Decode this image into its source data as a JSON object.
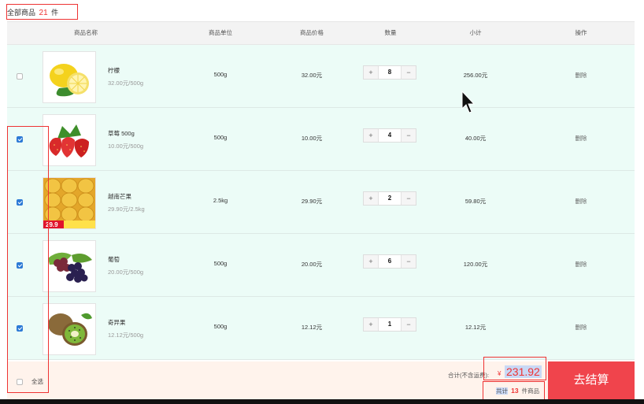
{
  "summary": {
    "prefix": "全部商品",
    "count": "21",
    "unit": "件"
  },
  "table": {
    "headers": [
      "商品名称",
      "商品单位",
      "商品价格",
      "数量",
      "小计",
      "操作"
    ],
    "rows": [
      {
        "checked": false,
        "name": "柠檬",
        "unit_price": "32.00元/500g",
        "unit": "500g",
        "price": "32.00元",
        "qty": "8",
        "subtotal": "256.00元",
        "action": "删除",
        "fruit": "lemon-image"
      },
      {
        "checked": true,
        "name": "草莓 500g",
        "unit_price": "10.00元/500g",
        "unit": "500g",
        "price": "10.00元",
        "qty": "4",
        "subtotal": "40.00元",
        "action": "删除",
        "fruit": "strawberry-image"
      },
      {
        "checked": true,
        "name": "越南芒果",
        "unit_price": "29.90元/2.5kg",
        "unit": "2.5kg",
        "price": "29.90元",
        "qty": "2",
        "subtotal": "59.80元",
        "action": "删除",
        "fruit": "mango-image",
        "badge": "29.9"
      },
      {
        "checked": true,
        "name": "葡萄",
        "unit_price": "20.00元/500g",
        "unit": "500g",
        "price": "20.00元",
        "qty": "6",
        "subtotal": "120.00元",
        "action": "删除",
        "fruit": "grape-image"
      },
      {
        "checked": true,
        "name": "奇异果",
        "unit_price": "12.12元/500g",
        "unit": "500g",
        "price": "12.12元",
        "qty": "1",
        "subtotal": "12.12元",
        "action": "删除",
        "fruit": "kiwi-image"
      }
    ]
  },
  "stepper": {
    "plus": "+",
    "minus": "−"
  },
  "footer": {
    "select_all": "全选",
    "total_label": "合计(不含运费):",
    "currency": "¥",
    "total": "231.92",
    "count_prefix": "共计",
    "count": "13",
    "count_suffix": "件商品",
    "checkout": "去结算"
  },
  "colors": {
    "accent": "#e33333",
    "checkout": "#f0444c",
    "row_bg": "#ecfcf7",
    "footer_bg": "#fff3ec",
    "checkbox": "#2d7ad6"
  }
}
